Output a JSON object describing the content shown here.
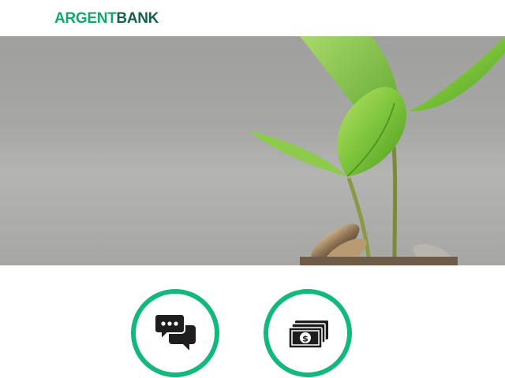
{
  "header": {
    "logo_part1": "ARGENT",
    "logo_part2": "BANK"
  },
  "hero": {
    "image": "plant-sprouting-from-coins"
  },
  "features": [
    {
      "icon": "chat-icon"
    },
    {
      "icon": "money-icon"
    }
  ],
  "colors": {
    "brand_green": "#13a86b",
    "brand_dark_green": "#13614a",
    "feature_ring": "#13b87c"
  }
}
